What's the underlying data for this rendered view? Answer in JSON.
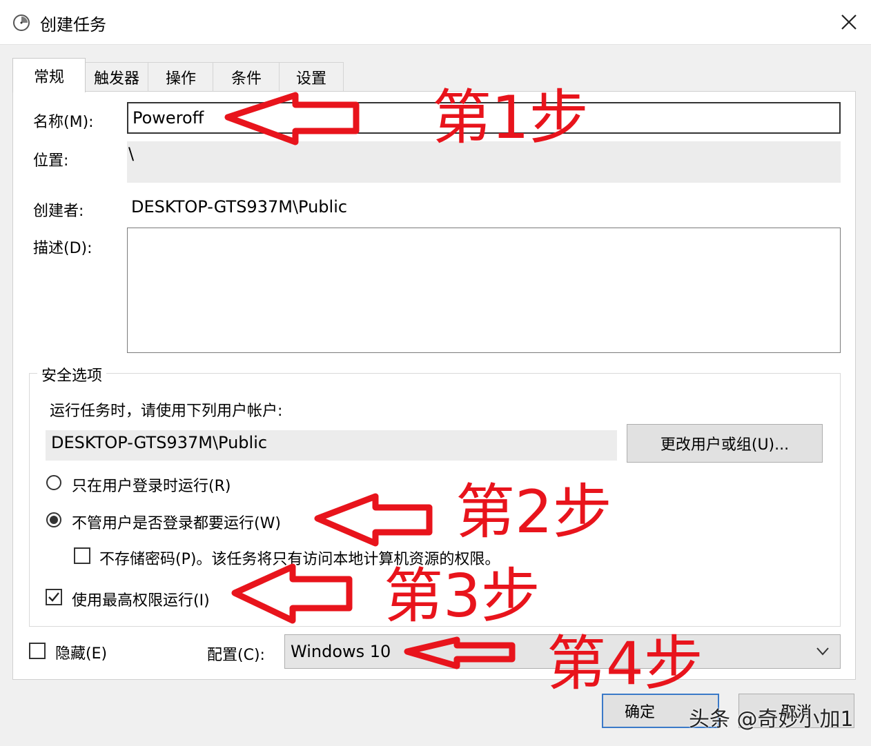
{
  "window": {
    "title": "创建任务",
    "icon": "task-scheduler-clock-icon"
  },
  "tabs": [
    {
      "label": "常规",
      "active": true
    },
    {
      "label": "触发器"
    },
    {
      "label": "操作"
    },
    {
      "label": "条件"
    },
    {
      "label": "设置"
    }
  ],
  "general": {
    "name_label": "名称(M):",
    "name_value": "Poweroff",
    "location_label": "位置:",
    "location_value": "\\",
    "author_label": "创建者:",
    "author_value": "DESKTOP-GTS937M\\Public",
    "description_label": "描述(D):",
    "description_value": ""
  },
  "security": {
    "legend": "安全选项",
    "run_as_label": "运行任务时，请使用下列用户帐户:",
    "user_account": "DESKTOP-GTS937M\\Public",
    "change_user_button": "更改用户或组(U)...",
    "option_logged_on": "只在用户登录时运行(R)",
    "option_always": "不管用户是否登录都要运行(W)",
    "selected_option": "option_always",
    "no_store_password": "不存储密码(P)。该任务将只有访问本地计算机资源的权限。",
    "no_store_password_checked": false,
    "highest_privileges": "使用最高权限运行(I)",
    "highest_privileges_checked": true
  },
  "bottom": {
    "hidden_label": "隐藏(E)",
    "hidden_checked": false,
    "configure_label": "配置(C):",
    "configure_value": "Windows 10"
  },
  "footer": {
    "ok_button": "确定",
    "cancel_button": "取消"
  },
  "annotations": {
    "step1": "第1步",
    "step2": "第2步",
    "step3": "第3步",
    "step4": "第4步",
    "arrow_color": "#e8141c"
  },
  "watermark": "头条 @奇妙小加1"
}
